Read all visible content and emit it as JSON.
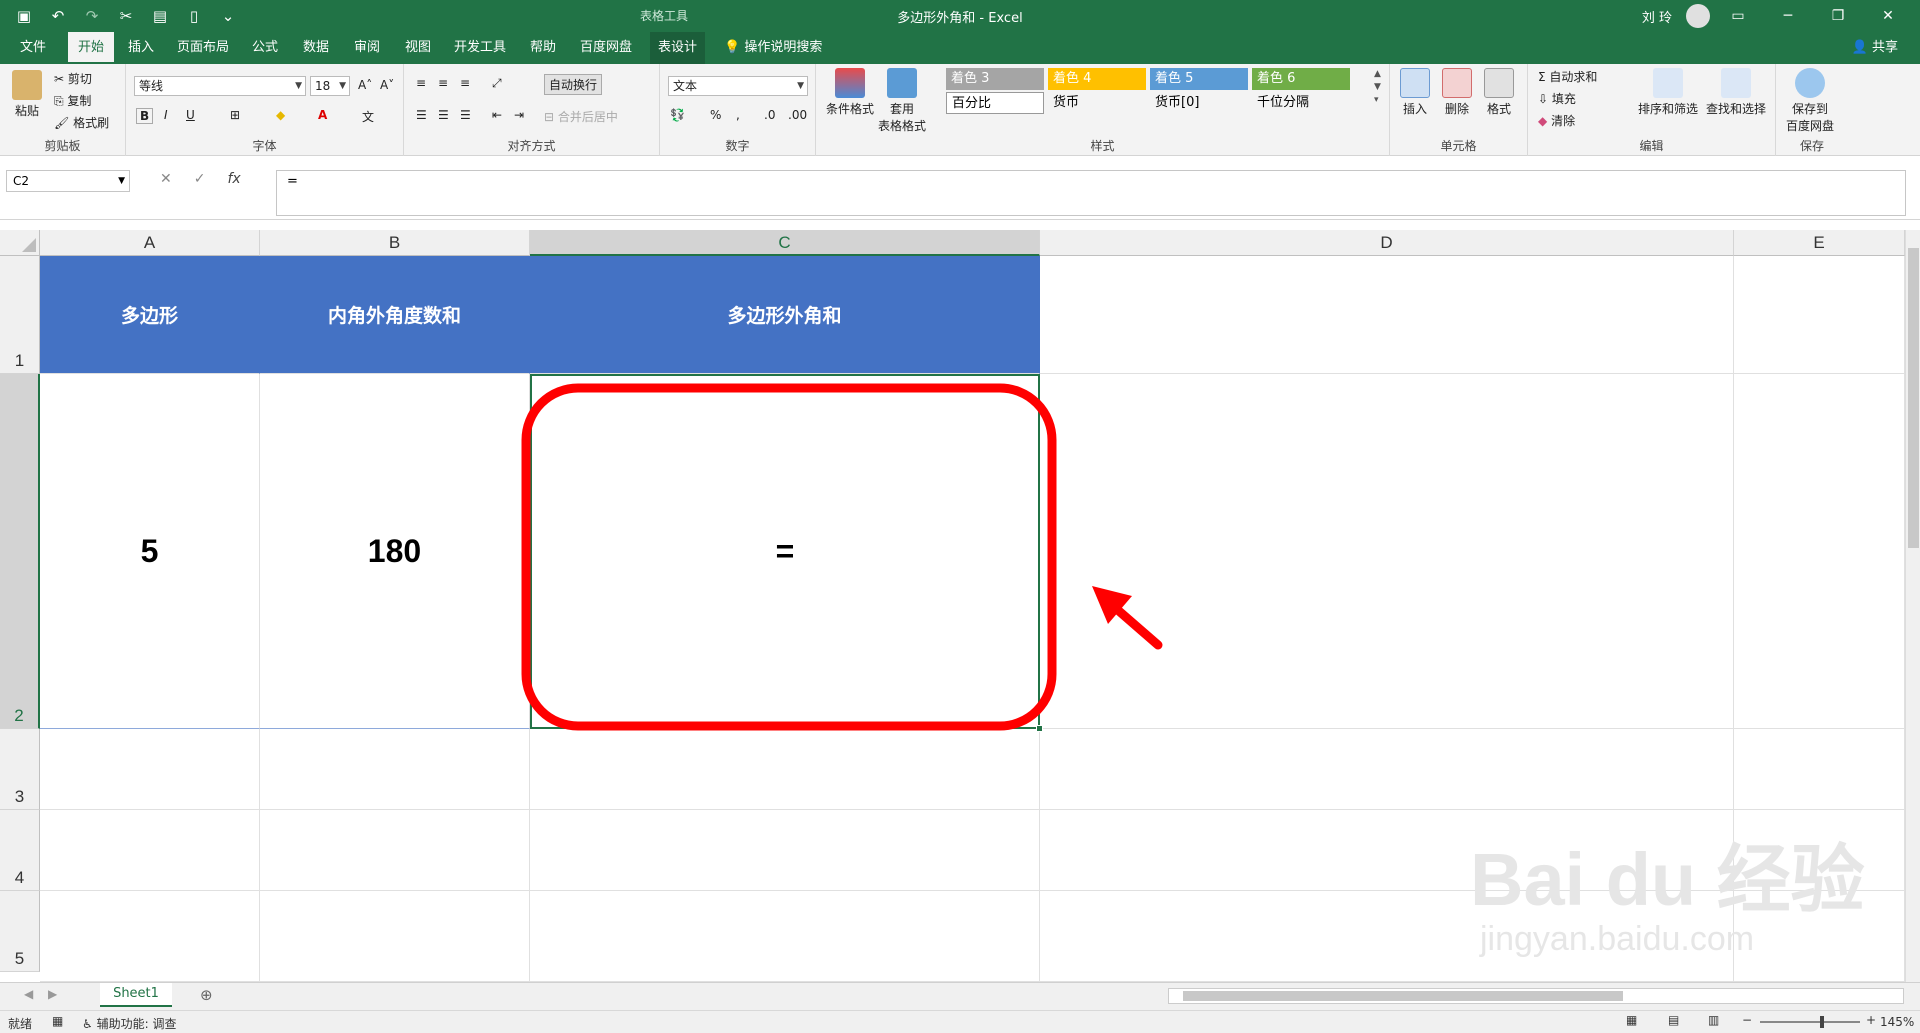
{
  "title_bar": {
    "context_tool": "表格工具",
    "title": "多边形外角和  -  Excel",
    "user": "刘 玲"
  },
  "tabs": [
    "文件",
    "开始",
    "插入",
    "页面布局",
    "公式",
    "数据",
    "审阅",
    "视图",
    "开发工具",
    "帮助",
    "百度网盘",
    "表设计"
  ],
  "active_tab": "开始",
  "tell_me": "操作说明搜索",
  "share": "共享",
  "ribbon": {
    "clipboard": {
      "paste": "粘贴",
      "cut": "剪切",
      "copy": "复制",
      "format_painter": "格式刷",
      "label": "剪贴板"
    },
    "font": {
      "name": "等线",
      "size": "18",
      "bold": "B",
      "italic": "I",
      "underline": "U",
      "label": "字体"
    },
    "alignment": {
      "wrap": "自动换行",
      "merge": "合并后居中",
      "label": "对齐方式"
    },
    "number": {
      "format": "文本",
      "percent": "%",
      "comma": ",",
      "label": "数字"
    },
    "styles": {
      "conditional": "条件格式",
      "table_format_1": "套用",
      "table_format_2": "表格格式",
      "cells": [
        {
          "text": "着色 3",
          "bg": "#a5a5a5",
          "fg": "#ffffff"
        },
        {
          "text": "着色 4",
          "bg": "#ffc000",
          "fg": "#ffffff"
        },
        {
          "text": "着色 5",
          "bg": "#5b9bd5",
          "fg": "#ffffff"
        },
        {
          "text": "着色 6",
          "bg": "#70ad47",
          "fg": "#ffffff"
        },
        {
          "text": "百分比",
          "bg": "#ffffff",
          "fg": "#000000"
        },
        {
          "text": "货币",
          "bg": "#f3f3f3",
          "fg": "#000000"
        },
        {
          "text": "货币[0]",
          "bg": "#f3f3f3",
          "fg": "#000000"
        },
        {
          "text": "千位分隔",
          "bg": "#f3f3f3",
          "fg": "#000000"
        }
      ],
      "label": "样式"
    },
    "cells": {
      "insert": "插入",
      "delete": "删除",
      "format": "格式",
      "label": "单元格"
    },
    "editing": {
      "autosum": "自动求和",
      "fill": "填充",
      "clear": "清除",
      "sort": "排序和筛选",
      "find": "查找和选择",
      "label": "编辑"
    },
    "save": {
      "line1": "保存到",
      "line2": "百度网盘",
      "label": "保存"
    }
  },
  "formula_bar": {
    "name_box": "C2",
    "cancel": "✕",
    "enter": "✓",
    "fx": "fx",
    "formula": "="
  },
  "columns": [
    "A",
    "B",
    "C",
    "D",
    "E"
  ],
  "rows": [
    "1",
    "2",
    "3",
    "4",
    "5"
  ],
  "sheet": {
    "header": [
      "多边形",
      "内角外角度数和",
      "多边形外角和"
    ],
    "values": [
      "5",
      "180",
      "="
    ]
  },
  "sheet_tabs": [
    "Sheet1"
  ],
  "status": {
    "ready": "就绪",
    "accessibility": "辅助功能: 调查",
    "zoom": "145%"
  },
  "watermark": {
    "brand": "Bai du 经验",
    "url": "jingyan.baidu.com"
  },
  "accent": "#217346",
  "annotation_color": "#ff0000"
}
